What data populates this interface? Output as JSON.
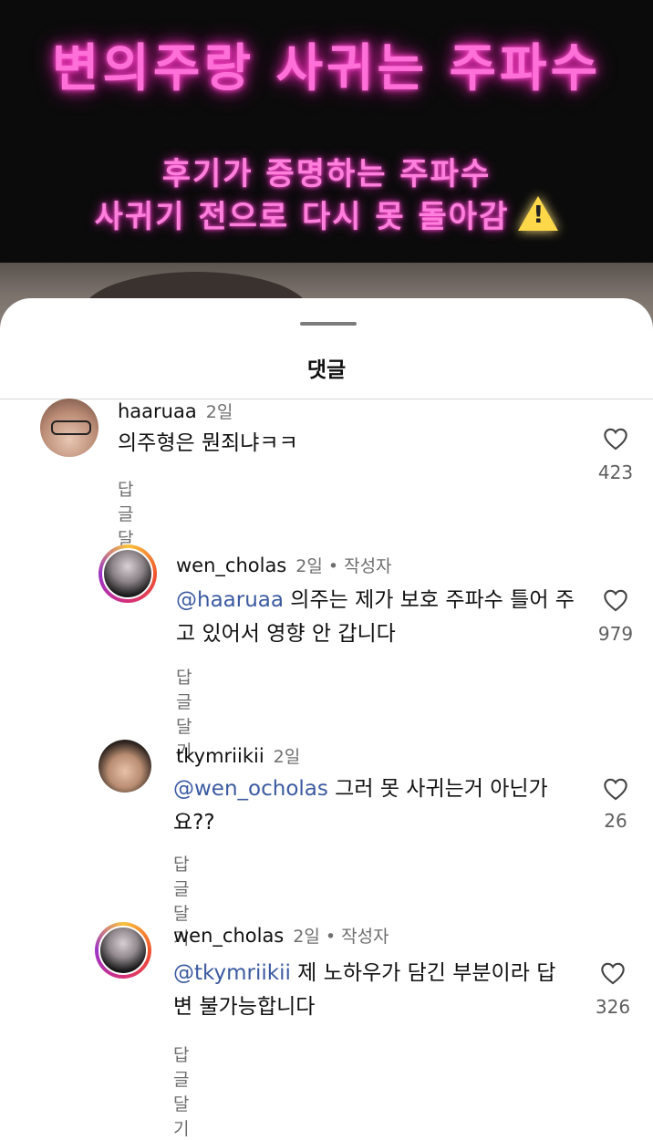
{
  "video": {
    "title": "변의주랑 사귀는 주파수",
    "subtitle_line1": "후기가 증명하는 주파수",
    "subtitle_line2": "사귀기 전으로 다시 못 돌아감",
    "warning_icon": "warning-icon"
  },
  "sheet": {
    "title": "댓글"
  },
  "comments": [
    {
      "username": "haaruaa",
      "time": "2일",
      "author_tag": "",
      "mention": "",
      "text": "의주형은 뭔죄냐ㅋㅋ",
      "reply_label": "답글 달기",
      "likes": "423"
    },
    {
      "username": "wen_cholas",
      "time": "2일",
      "author_tag": "• 작성자",
      "mention": "@haaruaa",
      "text": " 의주는 제가 보호 주파수 틀어 주고 있어서 영향 안 갑니다",
      "reply_label": "답글 달기",
      "likes": "979"
    },
    {
      "username": "tkymriikii",
      "time": "2일",
      "author_tag": "",
      "mention": "@wen_ocholas",
      "text": " 그러 못 사귀는거 아닌가요??",
      "reply_label": "답글 달기",
      "likes": "26"
    },
    {
      "username": "wen_cholas",
      "time": "2일",
      "author_tag": "• 작성자",
      "mention": "@tkymriikii",
      "text": " 제 노하우가 담긴 부분이라 답변 불가능합니다",
      "reply_label": "답글 달기",
      "likes": "326"
    }
  ],
  "colors": {
    "neon_pink": "#ff6fd8",
    "mention_blue": "#3b5aa0",
    "meta_gray": "#6e6e6e"
  }
}
